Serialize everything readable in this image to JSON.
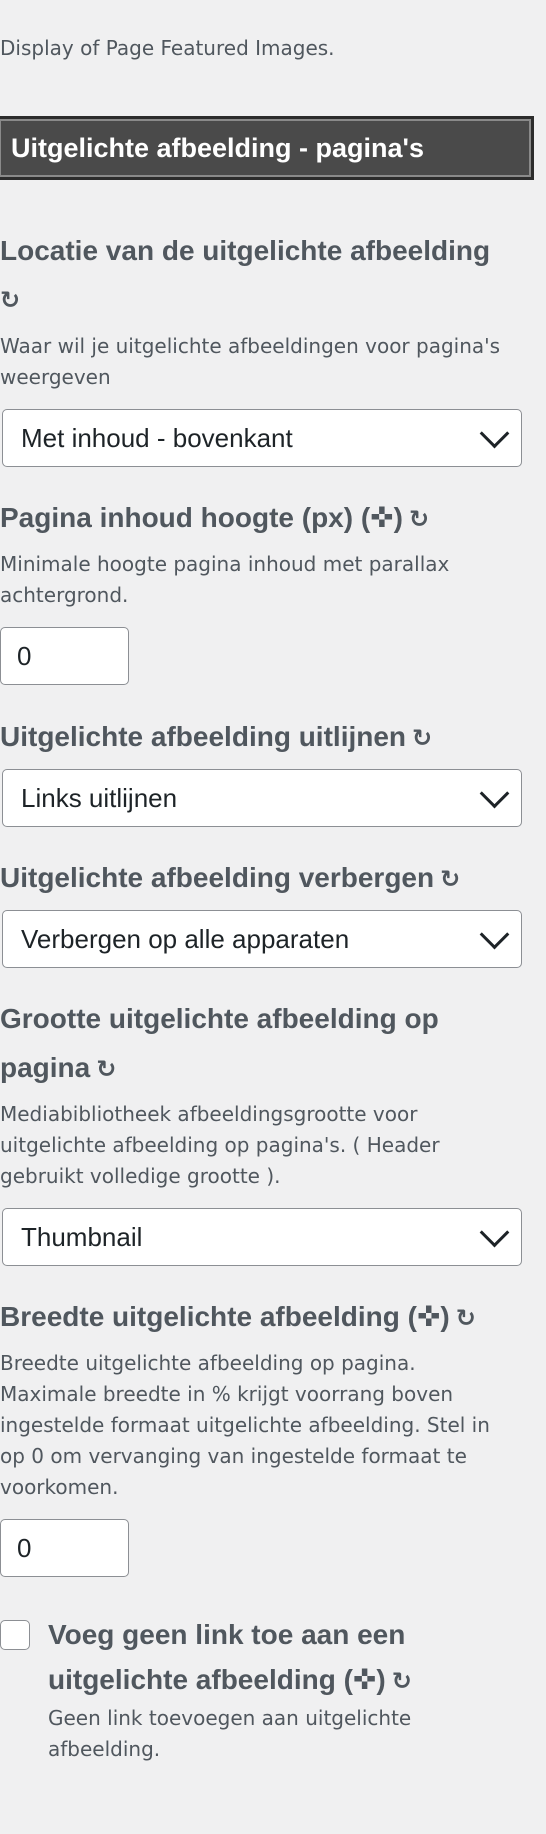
{
  "intro": "Display of Page Featured Images.",
  "section_title": "Uitgelichte afbeelding - pagina's",
  "reset_icon": "↻",
  "fields": {
    "location": {
      "label": "Locatie van de uitgelichte afbeelding",
      "description_1": "Waar wil je uitgelichte afbeeldingen voor pagina's",
      "description_2": "weergeven",
      "value": "Met inhoud - bovenkant"
    },
    "content_height": {
      "label": "Pagina inhoud hoogte (px) (✜)",
      "description_1": "Minimale hoogte pagina inhoud met parallax",
      "description_2": "achtergrond.",
      "value": "0"
    },
    "align": {
      "label": "Uitgelichte afbeelding uitlijnen",
      "value": "Links uitlijnen"
    },
    "hide": {
      "label": "Uitgelichte afbeelding verbergen",
      "value": "Verbergen op alle apparaten"
    },
    "size": {
      "label_1": "Grootte uitgelichte afbeelding op",
      "label_2": "pagina",
      "description_1": "Mediabibliotheek afbeeldingsgrootte voor",
      "description_2": "uitgelichte afbeelding op pagina's. ( Header",
      "description_3": "gebruikt volledige grootte ).",
      "value": "Thumbnail"
    },
    "width": {
      "label": "Breedte uitgelichte afbeelding (✜)",
      "description_1": "Breedte uitgelichte afbeelding op pagina.",
      "description_2": "Maximale breedte in % krijgt voorrang boven",
      "description_3": "ingestelde formaat uitgelichte afbeelding. Stel in",
      "description_4": "op 0 om vervanging van ingestelde formaat te",
      "description_5": "voorkomen.",
      "value": "0"
    },
    "no_link": {
      "label_1": "Voeg geen link toe aan een",
      "label_2": "uitgelichte afbeelding (✜)",
      "description_1": "Geen link toevoegen aan uitgelichte",
      "description_2": "afbeelding."
    }
  }
}
